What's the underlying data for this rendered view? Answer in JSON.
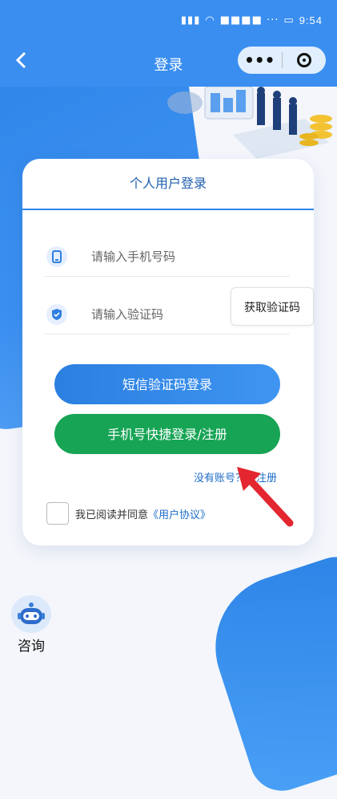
{
  "status_bar": {
    "time": "9:54"
  },
  "nav": {
    "title": "登录",
    "more": "•••"
  },
  "card": {
    "title": "个人用户登录",
    "phone_placeholder": "请输入手机号码",
    "code_placeholder": "请输入验证码",
    "get_code": "获取验证码",
    "sms_login": "短信验证码登录",
    "quick_login": "手机号快捷登录/注册",
    "register": "没有账号？去注册",
    "agree_prefix": "我已阅读并同意",
    "agreement": "《用户协议》"
  },
  "consult": {
    "label": "咨询"
  },
  "colors": {
    "primary": "#3a8ef0",
    "green": "#17a455",
    "link": "#1c6cc9"
  }
}
